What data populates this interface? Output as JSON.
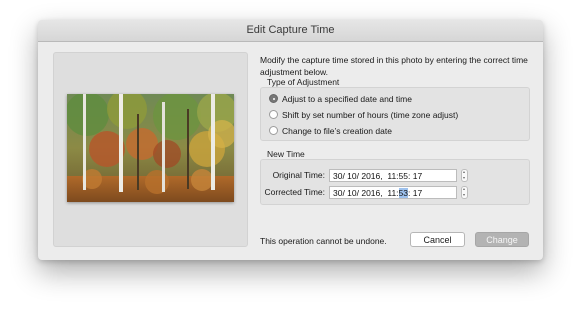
{
  "dialog": {
    "title": "Edit Capture Time",
    "description": "Modify the capture time stored in this photo by entering the correct time adjustment below.",
    "adjustment": {
      "label": "Type of Adjustment",
      "options": [
        {
          "label": "Adjust to a specified date and time",
          "selected": true
        },
        {
          "label": "Shift by set number of hours (time zone adjust)",
          "selected": false
        },
        {
          "label": "Change to file’s creation date",
          "selected": false
        }
      ]
    },
    "new_time": {
      "label": "New Time",
      "original_label": "Original Time:",
      "original_value": "30/ 10/ 2016,  11:55: 17",
      "corrected_label": "Corrected Time:",
      "corrected_prefix": "30/ 10/ 2016,  11:",
      "corrected_selected": "53",
      "corrected_suffix": ": 17"
    },
    "note": "This operation cannot be undone.",
    "buttons": {
      "cancel": "Cancel",
      "change": "Change"
    }
  },
  "colors": {
    "dialog_bg": "#ececec",
    "disabled_button": "#b3b3b3",
    "selection_highlight": "#9ec2ee"
  },
  "icons": [
    "radio-selected-icon",
    "radio-icon",
    "stepper-icon"
  ]
}
